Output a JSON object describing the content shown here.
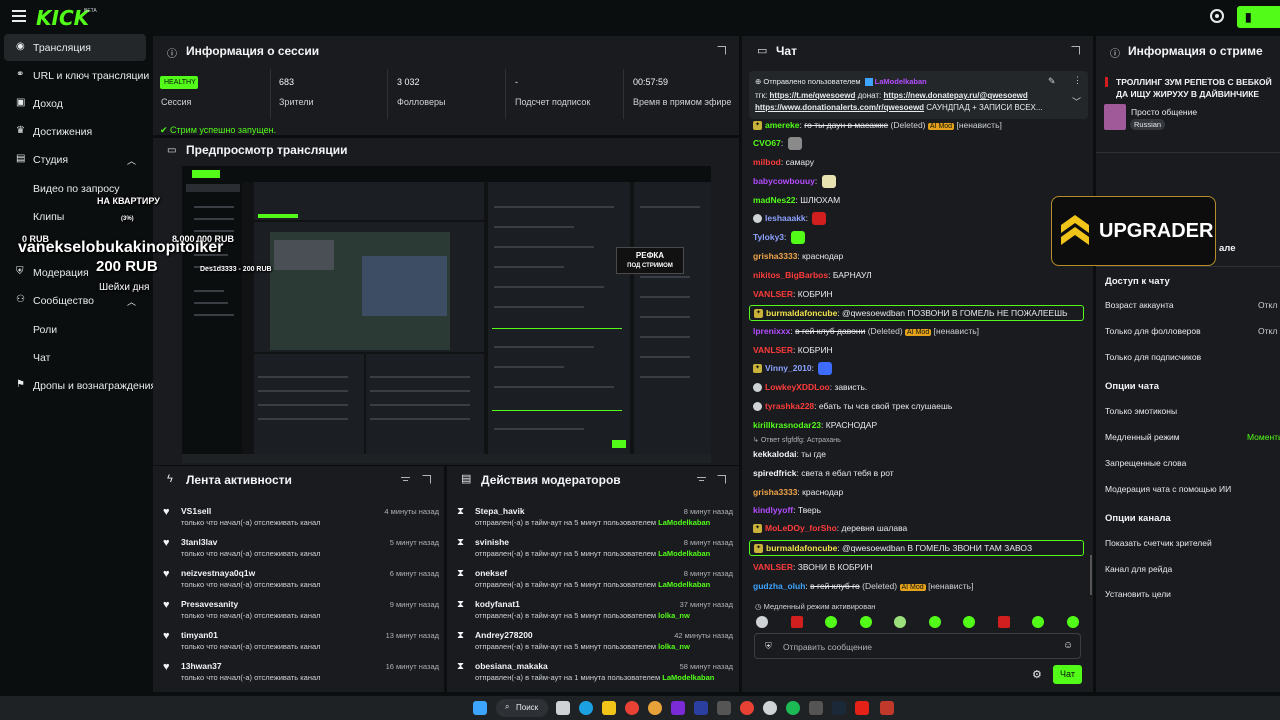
{
  "header": {
    "logo": "KICK",
    "beta": "BETA",
    "go_label": ""
  },
  "sidebar": {
    "items": [
      {
        "label": "Трансляция",
        "icon": "broadcast-icon"
      },
      {
        "label": "URL и ключ трансляции",
        "icon": "link-icon"
      },
      {
        "label": "Доход",
        "icon": "wallet-icon"
      },
      {
        "label": "Достижения",
        "icon": "trophy-icon"
      },
      {
        "label": "Студия",
        "icon": "studio-icon"
      },
      {
        "label": "Видео по запросу"
      },
      {
        "label": "Клипы"
      },
      {
        "label": "Модерация",
        "icon": "shield-icon"
      },
      {
        "label": "Сообщество",
        "icon": "community-icon"
      },
      {
        "label": "Роли"
      },
      {
        "label": "Чат"
      },
      {
        "label": "Дропы и вознаграждения",
        "icon": "gift-icon"
      }
    ]
  },
  "session": {
    "title": "Информация о сессии",
    "badge": "HEALTHY",
    "stats": [
      {
        "value": "",
        "label": "Сессия"
      },
      {
        "value": "683",
        "label": "Зрители"
      },
      {
        "value": "3 032",
        "label": "Фолловеры"
      },
      {
        "value": "-",
        "label": "Подсчет подписок"
      },
      {
        "value": "00:57:59",
        "label": "Время в прямом эфире"
      }
    ],
    "status": "Стрим успешно запущен."
  },
  "preview": {
    "title": "Предпросмотр трансляции",
    "refka_line1": "РЕФКА",
    "refka_line2": "ПОД СТРИМОМ"
  },
  "overlay": {
    "line1": "НА КВАРТИРУ",
    "line2": "(3%)",
    "line3": "8 000 000 RUB",
    "amount": "0 RUB",
    "donor": "vanekselobukakinopitoiker",
    "donor_amount": "200 RUB",
    "donor2": "Des1d3333 - 200 RUB",
    "note": "Шейхи дня"
  },
  "activity": {
    "title": "Лента активности",
    "rows": [
      {
        "name": "VS1sell",
        "desc": "только что начал(-а) отслеживать канал",
        "time": "4 минуты назад"
      },
      {
        "name": "3tanl3lav",
        "desc": "только что начал(-а) отслеживать канал",
        "time": "5 минут назад"
      },
      {
        "name": "neizvestnaya0q1w",
        "desc": "только что начал(-а) отслеживать канал",
        "time": "6 минут назад"
      },
      {
        "name": "Presavesanity",
        "desc": "только что начал(-а) отслеживать канал",
        "time": "9 минут назад"
      },
      {
        "name": "timyan01",
        "desc": "только что начал(-а) отслеживать канал",
        "time": "13 минут назад"
      },
      {
        "name": "13hwan37",
        "desc": "только что начал(-а) отслеживать канал",
        "time": "16 минут назад"
      }
    ]
  },
  "moderators": {
    "title": "Действия модераторов",
    "rows": [
      {
        "name": "Stepa_havik",
        "desc": "отправлен(-а) в тайм-аут на 5 минут пользователем",
        "by": "LaModelkaban",
        "time": "8 минут назад"
      },
      {
        "name": "svinishe",
        "desc": "отправлен(-а) в тайм-аут на 5 минут пользователем",
        "by": "LaModelkaban",
        "time": "8 минут назад"
      },
      {
        "name": "oneksef",
        "desc": "отправлен(-а) в тайм-аут на 5 минут пользователем",
        "by": "LaModelkaban",
        "time": "8 минут назад"
      },
      {
        "name": "kodyfanat1",
        "desc": "отправлен(-а) в тайм-аут на 5 минут пользователем",
        "by": "lolka_nw",
        "time": "37 минут назад"
      },
      {
        "name": "Andrey278200",
        "desc": "отправлен(-а) в тайм-аут на 5 минут пользователем",
        "by": "lolka_nw",
        "time": "42 минуты назад"
      },
      {
        "name": "obesiana_makaka",
        "desc": "отправлен(-а) в тайм-аут на 1 минута пользователем",
        "by": "LaModelkaban",
        "time": "58 минут назад"
      }
    ]
  },
  "chat": {
    "title": "Чат",
    "pinned_by": "Отправлено пользователем",
    "pinned_user": "LaModelkaban",
    "pinned_text1": "тгк:",
    "pinned_link1": "https://t.me/qwesoewd",
    "pinned_text2": "донат:",
    "pinned_link2": "https://new.donatepay.ru/@qwesoewd",
    "pinned_link3": "https://www.donationalerts.com/r/qwesoewd",
    "pinned_text3": "САУНДПАД + ЗАПИСИ ВСЕХ...",
    "messages": [
      {
        "user": "amereke",
        "color": "#53fc18",
        "text": "го ты даун в масажке",
        "deleted": "(Deleted)",
        "aimod": "AI Mod",
        "tag": "[ненависть]",
        "strike": true,
        "badge": "sub"
      },
      {
        "user": "CVO67",
        "color": "#53fc18",
        "text": "",
        "emote": "#8a8a8a"
      },
      {
        "user": "milbod",
        "color": "#ff3b3b",
        "text": "самару"
      },
      {
        "user": "babycowbouuy",
        "color": "#b44dff",
        "text": "",
        "emote": "#e8e1b0"
      },
      {
        "user": "madNes22",
        "color": "#53fc18",
        "text": "ШЛЮХАМ"
      },
      {
        "user": "leshaaakk",
        "color": "#8ea2ff",
        "text": "",
        "emote": "#d11f1f",
        "badge": "dot"
      },
      {
        "user": "Tyloky3",
        "color": "#8ea2ff",
        "text": "",
        "emote": "#53fc18"
      },
      {
        "user": "grisha3333",
        "color": "#f0a54a",
        "text": "краснодар"
      },
      {
        "user": "nikitos_BigBarbos",
        "color": "#ff3b3b",
        "text": "БАРНАУЛ"
      },
      {
        "user": "VANLSER",
        "color": "#ff3b3b",
        "text": "КОБРИН"
      },
      {
        "user": "burmaldafoncube",
        "color": "#f0e04a",
        "text": "@qwesoewdban ПОЗВОНИ В ГОМЕЛЬ НЕ ПОЖАЛЕЕШЬ",
        "hl": true,
        "badge": "sub"
      },
      {
        "user": "lprenixxx",
        "color": "#b44dff",
        "text": "в гей клуб давони",
        "deleted": "(Deleted)",
        "aimod": "AI Mod",
        "tag": "[ненависть]",
        "strike": true
      },
      {
        "user": "VANLSER",
        "color": "#ff3b3b",
        "text": "КОБРИН"
      },
      {
        "user": "Vinny_2010",
        "color": "#8ea2ff",
        "text": "",
        "emote": "#3d6cff",
        "badge": "sub"
      },
      {
        "user": "LowkeyXDDLoo",
        "color": "#ff3b3b",
        "text": "зависть.",
        "badge": "dot"
      },
      {
        "user": "tyrashka228",
        "color": "#ff3b3b",
        "text": "ебать ты чсв свой трек слушаешь",
        "badge": "dot"
      },
      {
        "user": "kirillkrasnodar23",
        "color": "#53fc18",
        "text": "КРАСНОДАР"
      },
      {
        "reply": "Ответ sfgfdfg: Астрахань"
      },
      {
        "user": "kekkalodai",
        "color": "#f2f4f5",
        "text": "ты где"
      },
      {
        "user": "spiredfrick",
        "color": "#f2f4f5",
        "text": "света я ебал тебя в рот"
      },
      {
        "user": "grisha3333",
        "color": "#f0a54a",
        "text": "краснодар"
      },
      {
        "user": "kindlyyoff",
        "color": "#b44dff",
        "text": "Тверь"
      },
      {
        "user": "MoLeDOy_forSho",
        "color": "#ff3b3b",
        "text": "деревня шалава",
        "badge": "sub"
      },
      {
        "user": "burmaldafoncube",
        "color": "#f0e04a",
        "text": "@qwesoewdban В ГОМЕЛЬ ЗВОНИ ТАМ ЗАВОЗ",
        "hl": true,
        "badge": "sub"
      },
      {
        "user": "VANLSER",
        "color": "#ff3b3b",
        "text": "ЗВОНИ В КОБРИН"
      },
      {
        "user": "gudzha_oluh",
        "color": "#3da5ff",
        "text": "в гей клуб го",
        "deleted": "(Deleted)",
        "aimod": "AI Mod",
        "tag": "[ненависть]",
        "strike": true
      }
    ],
    "slow_mode": "Медленный режим активирован",
    "input_placeholder": "Отправить сообщение",
    "send_label": "Чат"
  },
  "channel": {
    "title": "Информация о стриме",
    "stream_title": "ТРОЛЛИНГ ЗУМ РЕПЕТОВ С ВЕБКОЙ ДА ИЩУ ЖИРУХУ В ДАЙВИНЧИКЕ",
    "category": "Просто общение",
    "language": "Russian",
    "partial": "але",
    "sections": [
      {
        "heading": "Доступ к чату",
        "items": [
          {
            "label": "Возраст аккаунта",
            "value": "Откл"
          },
          {
            "label": "Только для фолловеров",
            "value": "Откл"
          },
          {
            "label": "Только для подписчиков",
            "value": ""
          }
        ]
      },
      {
        "heading": "Опции чата",
        "items": [
          {
            "label": "Только эмотиконы",
            "value": ""
          },
          {
            "label": "Медленный режим",
            "value": "Моменть"
          },
          {
            "label": "Запрещенные слова",
            "value": ""
          },
          {
            "label": "Модерация чата с помощью ИИ",
            "value": ""
          }
        ]
      },
      {
        "heading": "Опции канала",
        "items": [
          {
            "label": "Показать счетчик зрителей",
            "value": ""
          },
          {
            "label": "Канал для рейда",
            "value": ""
          },
          {
            "label": "Установить цели",
            "value": ""
          }
        ]
      }
    ]
  },
  "sponsor": {
    "label": "UPGRADER"
  },
  "taskbar": {
    "search": "Поиск"
  }
}
